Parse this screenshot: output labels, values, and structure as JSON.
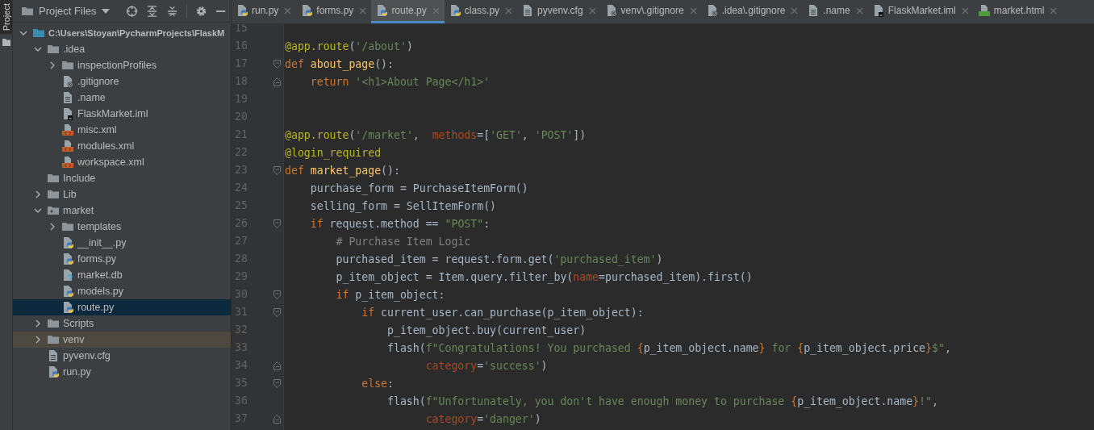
{
  "tool_strip": {
    "label": "Project"
  },
  "toolbar": {
    "view": "Project Files"
  },
  "tree": [
    {
      "name": "C:\\Users\\Stoyan\\PycharmProjects\\FlaskM",
      "kind": "folder-root",
      "expanded": true,
      "selected": false,
      "highlighted": false,
      "children": [
        {
          "name": ".idea",
          "kind": "folder",
          "expanded": true,
          "selected": false,
          "highlighted": false,
          "children": [
            {
              "name": "inspectionProfiles",
              "kind": "folder",
              "expanded": false,
              "selected": false,
              "highlighted": false
            },
            {
              "name": ".gitignore",
              "kind": "file-ignore",
              "selected": false,
              "highlighted": false
            },
            {
              "name": ".name",
              "kind": "file-text",
              "selected": false,
              "highlighted": false
            },
            {
              "name": "FlaskMarket.iml",
              "kind": "file-iml",
              "selected": false,
              "highlighted": false
            },
            {
              "name": "misc.xml",
              "kind": "file-xml",
              "selected": false,
              "highlighted": false
            },
            {
              "name": "modules.xml",
              "kind": "file-xml",
              "selected": false,
              "highlighted": false
            },
            {
              "name": "workspace.xml",
              "kind": "file-xml",
              "selected": false,
              "highlighted": false
            }
          ]
        },
        {
          "name": "Include",
          "kind": "folder",
          "selected": false,
          "highlighted": false
        },
        {
          "name": "Lib",
          "kind": "folder",
          "expanded": false,
          "selected": false,
          "highlighted": false
        },
        {
          "name": "market",
          "kind": "folder-package",
          "expanded": true,
          "selected": false,
          "highlighted": false,
          "children": [
            {
              "name": "templates",
              "kind": "folder",
              "expanded": false,
              "selected": false,
              "highlighted": false
            },
            {
              "name": "__init__.py",
              "kind": "file-python",
              "selected": false,
              "highlighted": false
            },
            {
              "name": "forms.py",
              "kind": "file-python",
              "selected": false,
              "highlighted": false
            },
            {
              "name": "market.db",
              "kind": "file-unknown",
              "selected": false,
              "highlighted": false
            },
            {
              "name": "models.py",
              "kind": "file-python",
              "selected": false,
              "highlighted": false
            },
            {
              "name": "route.py",
              "kind": "file-python",
              "selected": true,
              "highlighted": false
            }
          ]
        },
        {
          "name": "Scripts",
          "kind": "folder",
          "expanded": false,
          "selected": false,
          "highlighted": false
        },
        {
          "name": "venv",
          "kind": "folder",
          "expanded": false,
          "selected": false,
          "highlighted": true
        },
        {
          "name": "pyvenv.cfg",
          "kind": "file-text",
          "selected": false,
          "highlighted": false
        },
        {
          "name": "run.py",
          "kind": "file-python",
          "selected": false,
          "highlighted": false
        }
      ]
    }
  ],
  "tabs": [
    {
      "label": "run.py",
      "kind": "file-python",
      "selected": false
    },
    {
      "label": "forms.py",
      "kind": "file-python",
      "selected": false
    },
    {
      "label": "route.py",
      "kind": "file-python",
      "selected": true
    },
    {
      "label": "class.py",
      "kind": "file-python",
      "selected": false
    },
    {
      "label": "pyvenv.cfg",
      "kind": "file-text",
      "selected": false
    },
    {
      "label": "venv\\.gitignore",
      "kind": "file-ignore",
      "selected": false
    },
    {
      "label": ".idea\\.gitignore",
      "kind": "file-ignore",
      "selected": false
    },
    {
      "label": ".name",
      "kind": "file-text",
      "selected": false
    },
    {
      "label": "FlaskMarket.iml",
      "kind": "file-iml",
      "selected": false
    },
    {
      "label": "market.html",
      "kind": "file-html",
      "selected": false
    }
  ],
  "code_lines": [
    {
      "number": "15",
      "fold_start": false,
      "fold_end": false
    },
    {
      "number": "16",
      "fold_start": false,
      "fold_end": false,
      "tokens": [
        {
          "kind": "deco",
          "text": "@app.route"
        },
        {
          "kind": "plain",
          "text": "("
        },
        {
          "kind": "str",
          "text": "'/about'"
        },
        {
          "kind": "plain",
          "text": ")"
        }
      ]
    },
    {
      "number": "17",
      "fold_start": true,
      "fold_end": false,
      "tokens": [
        {
          "kind": "kw",
          "text": "def"
        },
        {
          "kind": "fn",
          "text": " about_page"
        },
        {
          "kind": "plain",
          "text": "():"
        }
      ]
    },
    {
      "number": "18",
      "fold_start": false,
      "fold_end": true,
      "tokens": [
        {
          "kind": "kw",
          "text": "    return"
        },
        {
          "kind": "str",
          "text": " '<h1>About Page</h1>'"
        }
      ]
    },
    {
      "number": "19",
      "fold_start": false,
      "fold_end": false
    },
    {
      "number": "20",
      "fold_start": false,
      "fold_end": false
    },
    {
      "number": "21",
      "fold_start": false,
      "fold_end": false,
      "tokens": [
        {
          "kind": "deco",
          "text": "@app.route"
        },
        {
          "kind": "plain",
          "text": "("
        },
        {
          "kind": "str",
          "text": "'/market'"
        },
        {
          "kind": "plain",
          "text": ",  "
        },
        {
          "kind": "param",
          "text": "methods"
        },
        {
          "kind": "plain",
          "text": "=["
        },
        {
          "kind": "str",
          "text": "'GET'"
        },
        {
          "kind": "plain",
          "text": ", "
        },
        {
          "kind": "str",
          "text": "'POST'"
        },
        {
          "kind": "plain",
          "text": "])"
        }
      ]
    },
    {
      "number": "22",
      "fold_start": false,
      "fold_end": false,
      "tokens": [
        {
          "kind": "deco",
          "text": "@login_required"
        }
      ]
    },
    {
      "number": "23",
      "fold_start": true,
      "fold_end": false,
      "tokens": [
        {
          "kind": "kw",
          "text": "def"
        },
        {
          "kind": "fn",
          "text": " market_page"
        },
        {
          "kind": "plain",
          "text": "():"
        }
      ]
    },
    {
      "number": "24",
      "fold_start": false,
      "fold_end": false,
      "tokens": [
        {
          "kind": "plain",
          "text": "    purchase_form = PurchaseItemForm()"
        }
      ]
    },
    {
      "number": "25",
      "fold_start": false,
      "fold_end": false,
      "tokens": [
        {
          "kind": "plain",
          "text": "    selling_form = SellItemForm()"
        }
      ]
    },
    {
      "number": "26",
      "fold_start": true,
      "fold_end": false,
      "tokens": [
        {
          "kind": "kw",
          "text": "    if"
        },
        {
          "kind": "plain",
          "text": " request.method == "
        },
        {
          "kind": "str",
          "text": "\"POST\""
        },
        {
          "kind": "plain",
          "text": ":"
        }
      ]
    },
    {
      "number": "27",
      "fold_start": false,
      "fold_end": false,
      "tokens": [
        {
          "kind": "comment",
          "text": "        # Purchase Item Logic"
        }
      ]
    },
    {
      "number": "28",
      "fold_start": false,
      "fold_end": false,
      "tokens": [
        {
          "kind": "plain",
          "text": "        purchased_item = request.form.get("
        },
        {
          "kind": "str",
          "text": "'purchased_item'"
        },
        {
          "kind": "plain",
          "text": ")"
        }
      ]
    },
    {
      "number": "29",
      "fold_start": false,
      "fold_end": false,
      "tokens": [
        {
          "kind": "plain",
          "text": "        p_item_object = Item.query.filter_by("
        },
        {
          "kind": "param",
          "text": "name"
        },
        {
          "kind": "plain",
          "text": "=purchased_item).first()"
        }
      ]
    },
    {
      "number": "30",
      "fold_start": true,
      "fold_end": false,
      "tokens": [
        {
          "kind": "kw",
          "text": "        if"
        },
        {
          "kind": "plain",
          "text": " p_item_object:"
        }
      ]
    },
    {
      "number": "31",
      "fold_start": true,
      "fold_end": false,
      "tokens": [
        {
          "kind": "kw",
          "text": "            if"
        },
        {
          "kind": "plain",
          "text": " current_user.can_purchase(p_item_object):"
        }
      ]
    },
    {
      "number": "32",
      "fold_start": false,
      "fold_end": false,
      "tokens": [
        {
          "kind": "plain",
          "text": "                p_item_object.buy(current_user)"
        }
      ]
    },
    {
      "number": "33",
      "fold_start": false,
      "fold_end": false,
      "tokens": [
        {
          "kind": "plain",
          "text": "                flash("
        },
        {
          "kind": "str",
          "text": "f\"Congratulations! You purchased "
        },
        {
          "kind": "kw",
          "text": "{"
        },
        {
          "kind": "plain",
          "text": "p_item_object.name"
        },
        {
          "kind": "kw",
          "text": "}"
        },
        {
          "kind": "str",
          "text": " for "
        },
        {
          "kind": "kw",
          "text": "{"
        },
        {
          "kind": "plain",
          "text": "p_item_object.price"
        },
        {
          "kind": "kw",
          "text": "}"
        },
        {
          "kind": "str",
          "text": "$\""
        },
        {
          "kind": "plain",
          "text": ","
        }
      ]
    },
    {
      "number": "34",
      "fold_start": false,
      "fold_end": true,
      "tokens": [
        {
          "kind": "param",
          "text": "                      category"
        },
        {
          "kind": "plain",
          "text": "="
        },
        {
          "kind": "str",
          "text": "'success'"
        },
        {
          "kind": "plain",
          "text": ")"
        }
      ]
    },
    {
      "number": "35",
      "fold_start": true,
      "fold_end": false,
      "tokens": [
        {
          "kind": "kw",
          "text": "            else"
        },
        {
          "kind": "plain",
          "text": ":"
        }
      ]
    },
    {
      "number": "36",
      "fold_start": false,
      "fold_end": false,
      "tokens": [
        {
          "kind": "plain",
          "text": "                flash("
        },
        {
          "kind": "str",
          "text": "f\"Unfortunately, you don't have enough money to purchase "
        },
        {
          "kind": "kw",
          "text": "{"
        },
        {
          "kind": "plain",
          "text": "p_item_object.name"
        },
        {
          "kind": "kw",
          "text": "}"
        },
        {
          "kind": "str",
          "text": "!\""
        },
        {
          "kind": "plain",
          "text": ","
        }
      ]
    },
    {
      "number": "37",
      "fold_start": false,
      "fold_end": true,
      "tokens": [
        {
          "kind": "param",
          "text": "                      category"
        },
        {
          "kind": "plain",
          "text": "="
        },
        {
          "kind": "str",
          "text": "'danger'"
        },
        {
          "kind": "plain",
          "text": ")"
        }
      ]
    }
  ]
}
